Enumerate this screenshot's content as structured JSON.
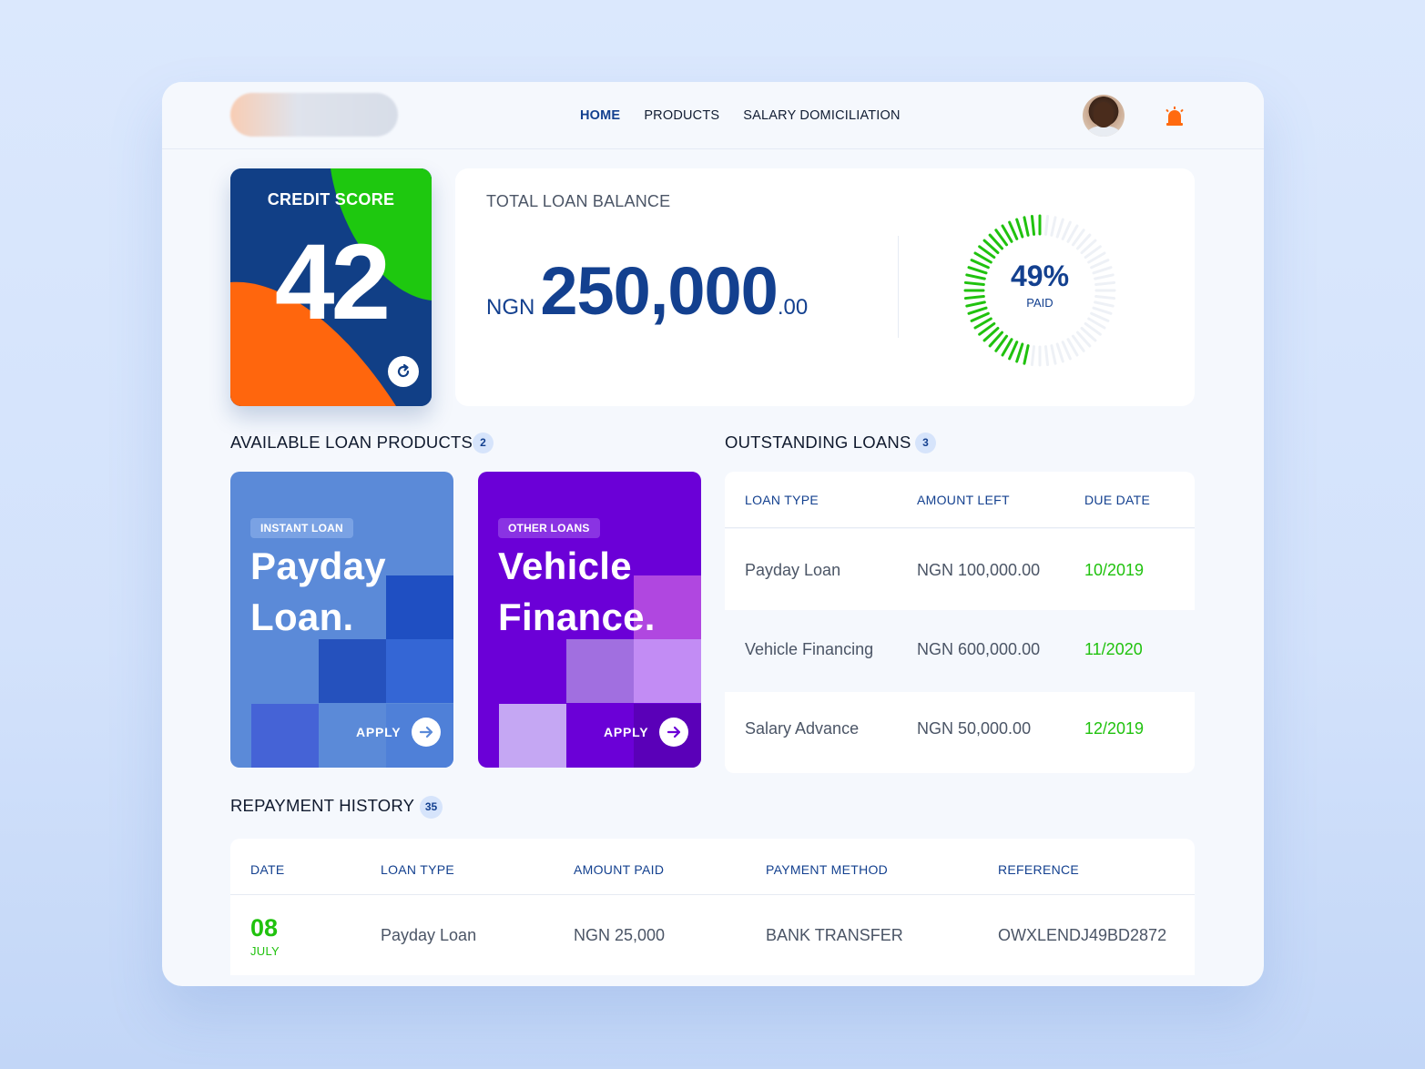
{
  "nav": {
    "items": [
      {
        "label": "HOME",
        "active": true
      },
      {
        "label": "PRODUCTS",
        "active": false
      },
      {
        "label": "SALARY DOMICILIATION",
        "active": false
      }
    ]
  },
  "icons": {
    "avatar": "user-avatar",
    "notification": "alarm-bell-icon",
    "refresh": "refresh-icon",
    "apply": "arrow-right-icon"
  },
  "colors": {
    "primary": "#13408f",
    "green": "#20c20e",
    "orange": "#ff6a0f",
    "purple": "#6b00d7",
    "blue_card": "#5b8ad8"
  },
  "credit_score": {
    "label": "CREDIT SCORE",
    "value": "42"
  },
  "balance": {
    "title": "TOTAL LOAN BALANCE",
    "currency": "NGN",
    "amount": "250,000",
    "decimals": ".00",
    "paid_percent": "49%",
    "paid_label": "PAID",
    "paid_fraction": 0.49
  },
  "products": {
    "title": "AVAILABLE LOAN PRODUCTS",
    "count": "2",
    "items": [
      {
        "tag": "INSTANT LOAN",
        "title": "Payday Loan.",
        "apply": "APPLY"
      },
      {
        "tag": "OTHER LOANS",
        "title": "Vehicle Finance.",
        "apply": "APPLY"
      }
    ]
  },
  "outstanding": {
    "title": "OUTSTANDING LOANS",
    "count": "3",
    "columns": [
      "LOAN TYPE",
      "AMOUNT LEFT",
      "DUE DATE"
    ],
    "rows": [
      {
        "type": "Payday Loan",
        "amount": "NGN 100,000.00",
        "due": "10/2019"
      },
      {
        "type": "Vehicle Financing",
        "amount": "NGN 600,000.00",
        "due": "11/2020"
      },
      {
        "type": "Salary Advance",
        "amount": "NGN 50,000.00",
        "due": "12/2019"
      }
    ]
  },
  "history": {
    "title": "REPAYMENT HISTORY",
    "count": "35",
    "columns": [
      "DATE",
      "LOAN TYPE",
      "AMOUNT PAID",
      "PAYMENT METHOD",
      "REFERENCE"
    ],
    "rows": [
      {
        "day": "08",
        "month": "JULY",
        "type": "Payday Loan",
        "amount": "NGN 25,000",
        "method": "BANK TRANSFER",
        "reference": "OWXLENDJ49BD2872"
      }
    ]
  }
}
